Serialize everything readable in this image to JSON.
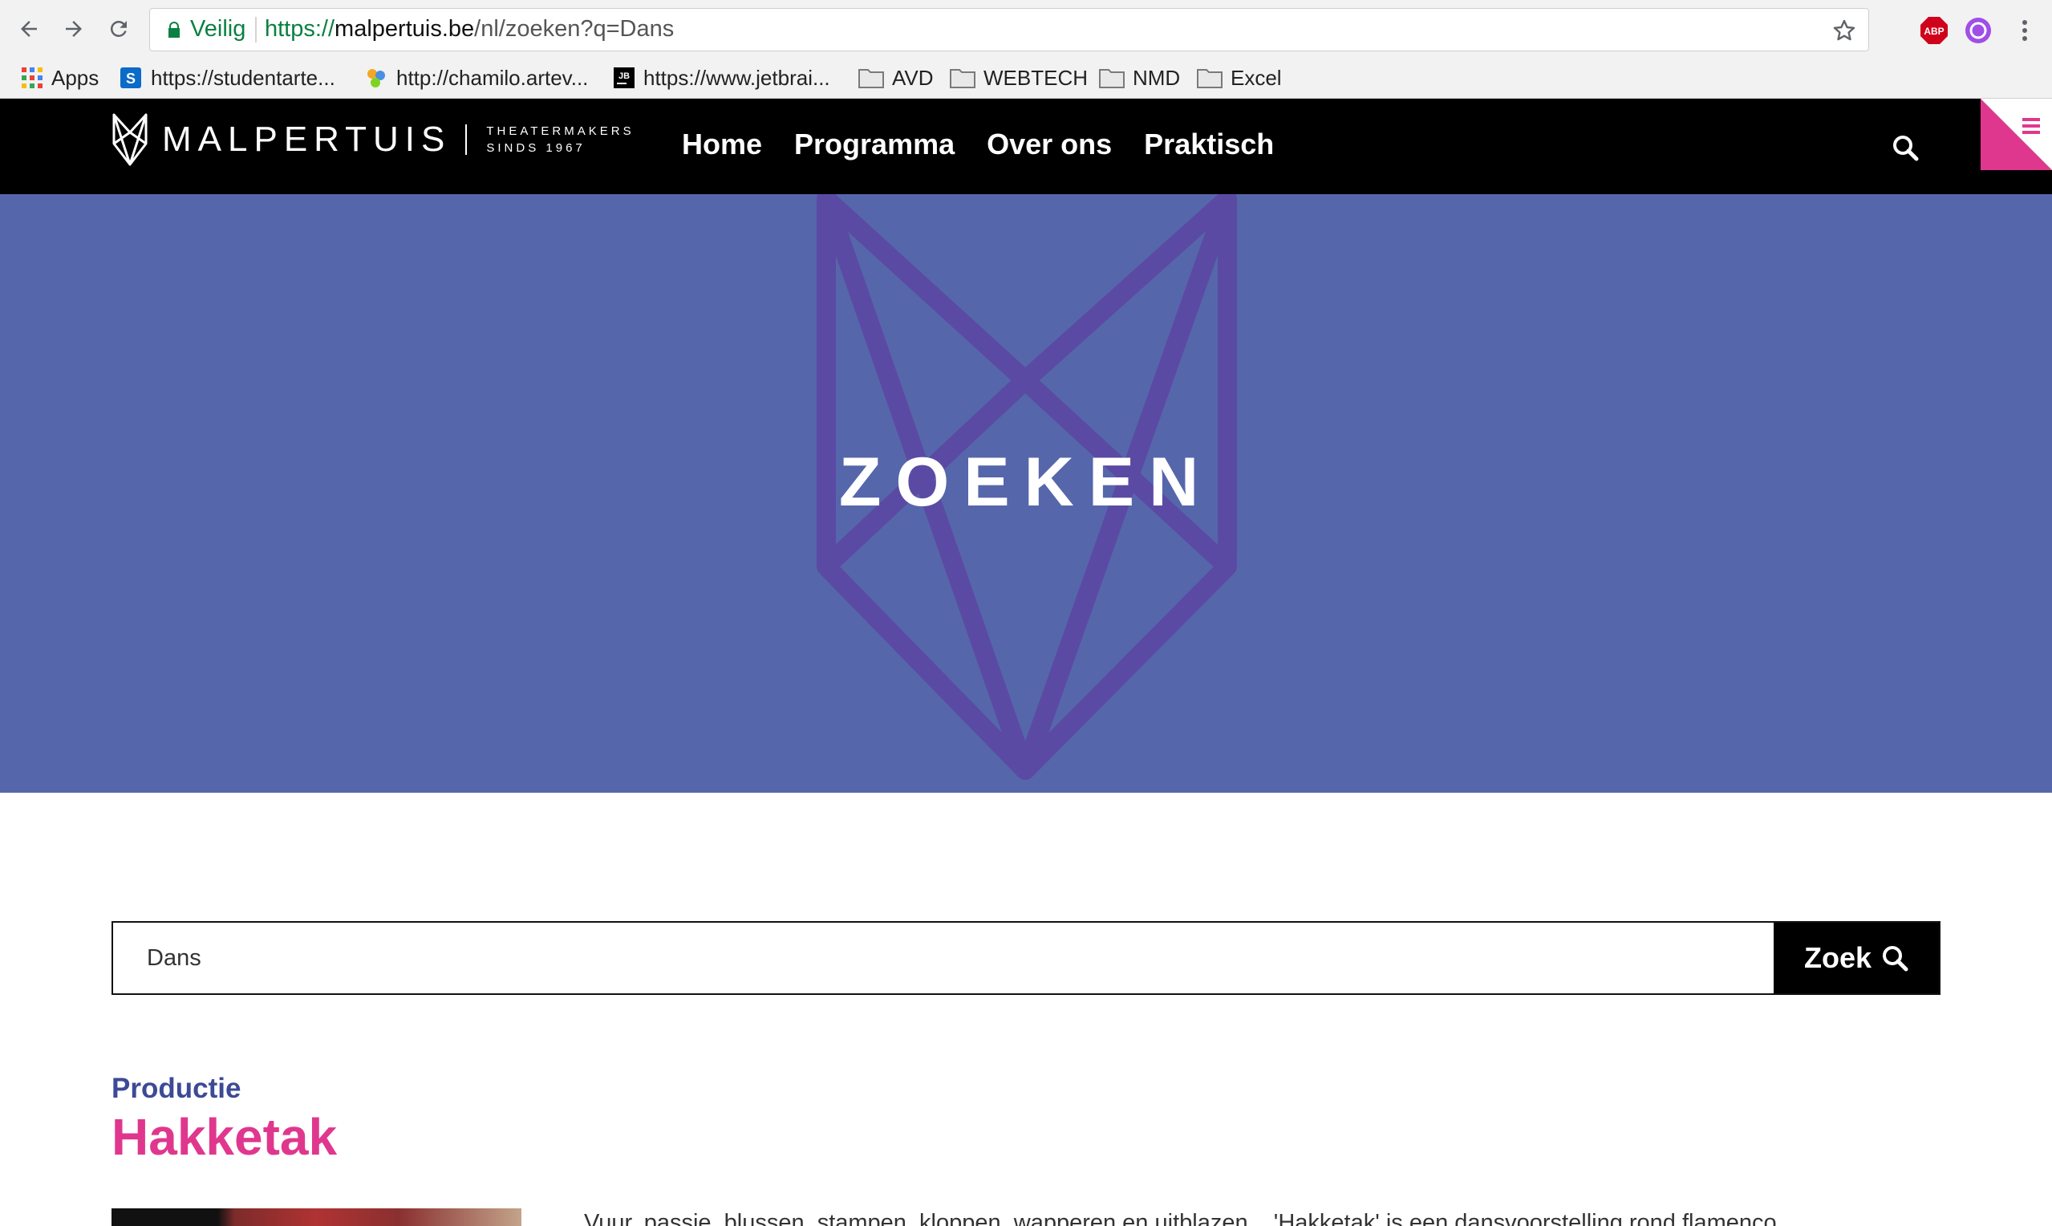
{
  "browser": {
    "secure_label": "Veilig",
    "url_scheme": "https://",
    "url_host": "malpertuis.be",
    "url_path": "/nl/zoeken?q=Dans",
    "bookmarks": [
      {
        "label": "Apps",
        "icon": "apps-grid-icon"
      },
      {
        "label": "https://studentarte...",
        "icon": "sharepoint-icon"
      },
      {
        "label": "http://chamilo.artev...",
        "icon": "chamilo-icon"
      },
      {
        "label": "https://www.jetbrai...",
        "icon": "jetbrains-icon"
      },
      {
        "label": "AVD",
        "icon": "folder-icon"
      },
      {
        "label": "WEBTECH",
        "icon": "folder-icon"
      },
      {
        "label": "NMD",
        "icon": "folder-icon"
      },
      {
        "label": "Excel",
        "icon": "folder-icon"
      }
    ],
    "extension_abp": "ABP"
  },
  "site": {
    "logo_word": "MALPERTUIS",
    "logo_tag_line1": "THEATERMAKERS",
    "logo_tag_line2": "SINDS 1967",
    "nav": [
      "Home",
      "Programma",
      "Over ons",
      "Praktisch"
    ],
    "accent_color": "#e0378e",
    "hero_color": "#5666aa"
  },
  "hero": {
    "title": "ZOEKEN"
  },
  "search": {
    "value": "Dans",
    "button_label": "Zoek"
  },
  "result": {
    "type": "Productie",
    "title": "Hakketak",
    "excerpt": "Vuur, passie, blussen, stampen, kloppen, wapperen en uitblazen... 'Hakketak' is een dansvoorstelling rond flamenco."
  }
}
